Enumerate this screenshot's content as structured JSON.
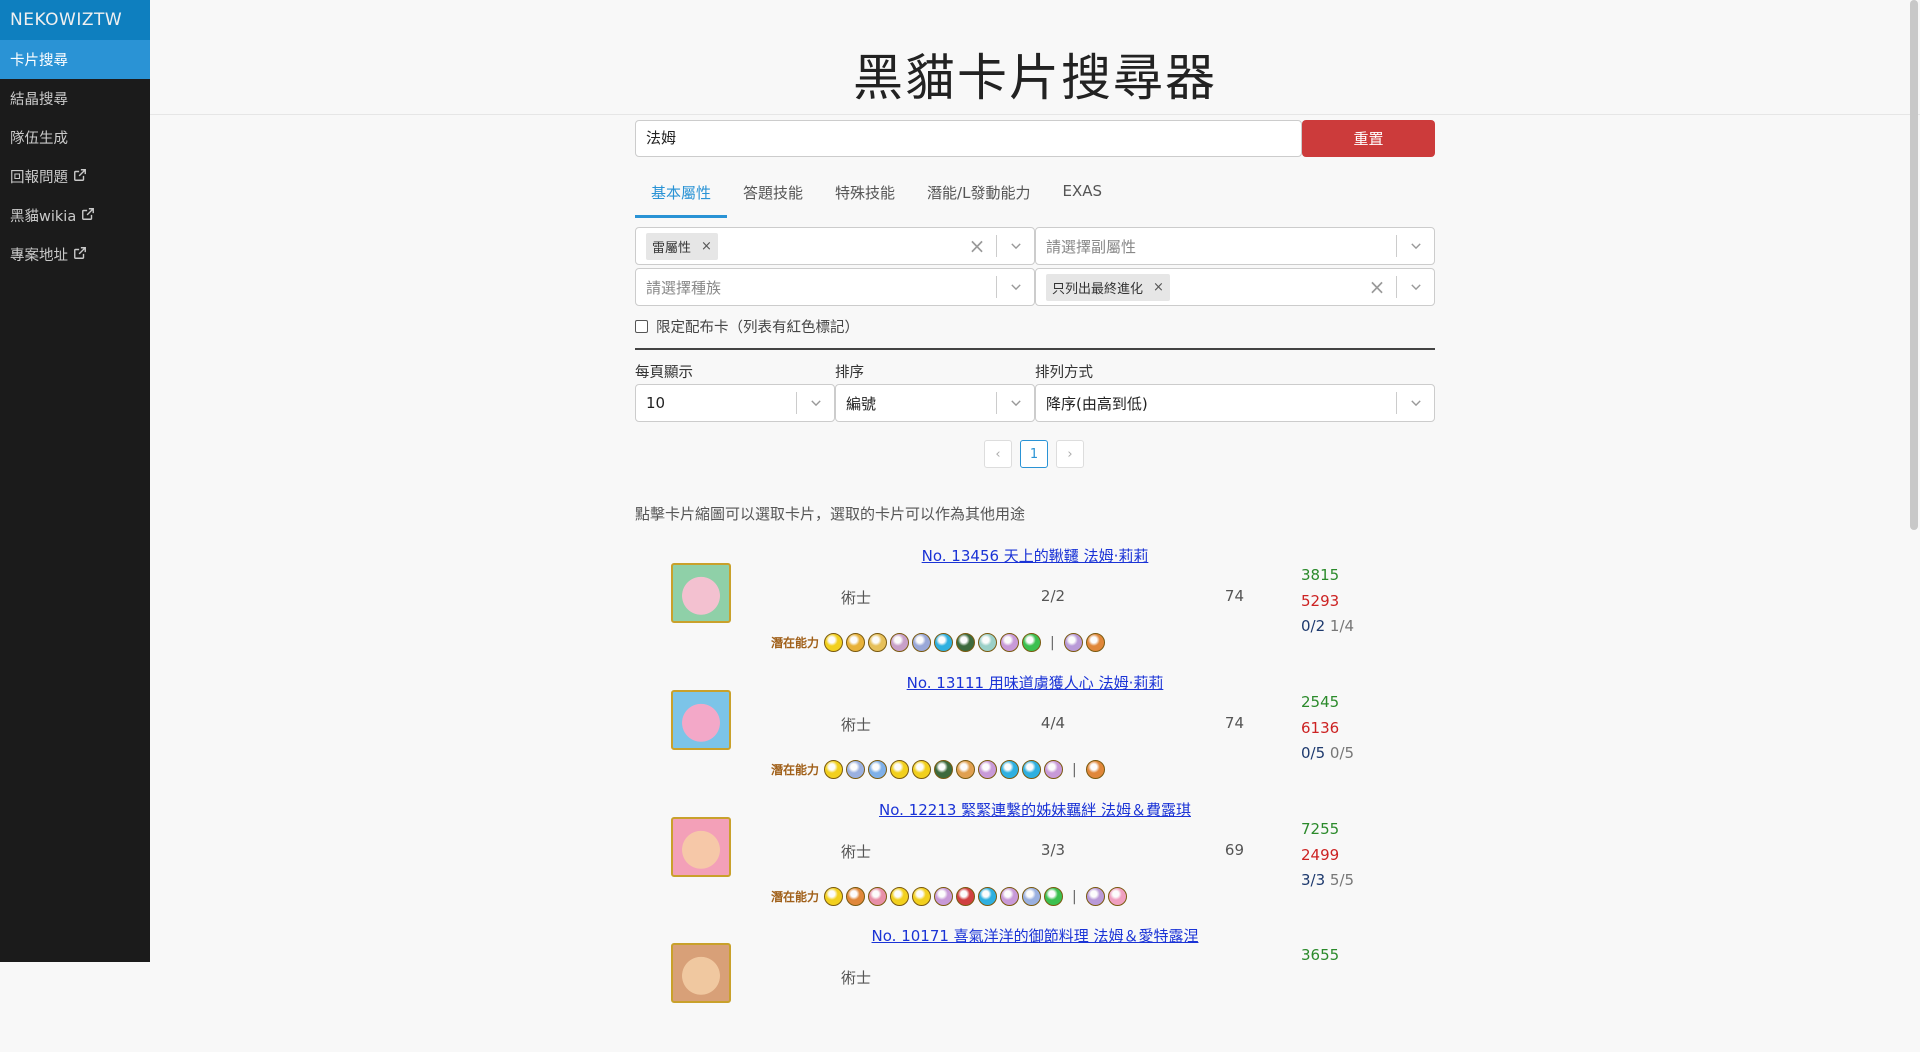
{
  "sidebar": {
    "brand": "NEKOWIZTW",
    "items": [
      {
        "label": "卡片搜尋",
        "active": true,
        "external": false
      },
      {
        "label": "結晶搜尋",
        "active": false,
        "external": false
      },
      {
        "label": "隊伍生成",
        "active": false,
        "external": false
      },
      {
        "label": "回報問題",
        "active": false,
        "external": true
      },
      {
        "label": "黑貓wikia",
        "active": false,
        "external": true
      },
      {
        "label": "專案地址",
        "active": false,
        "external": true
      }
    ]
  },
  "header": {
    "title": "黑貓卡片搜尋器"
  },
  "search": {
    "value": "法姆",
    "reset_label": "重置"
  },
  "tabs": [
    "基本屬性",
    "答題技能",
    "特殊技能",
    "潛能/L發動能力",
    "EXAS"
  ],
  "filters": {
    "main_attr_chip": "雷屬性",
    "sub_attr_placeholder": "請選擇副屬性",
    "race_placeholder": "請選擇種族",
    "evolution_chip": "只列出最終進化",
    "limited_label": "限定配布卡（列表有紅色標記）"
  },
  "options": {
    "per_page_label": "每頁顯示",
    "per_page_value": "10",
    "sort_label": "排序",
    "sort_value": "編號",
    "order_label": "排列方式",
    "order_value": "降序(由高到低)"
  },
  "pagination": {
    "prev": "‹",
    "current": "1",
    "next": "›"
  },
  "hint": "點擊卡片縮圖可以選取卡片，選取的卡片可以作為其他用途",
  "ability_label": "潛在能力",
  "cards": [
    {
      "title": "No. 13456 天上的鞦韆 法姆·莉莉",
      "class": "術士",
      "evolution": "2/2",
      "cost": "74",
      "hp": "3815",
      "atk": "5293",
      "skill_a": "0/2",
      "skill_b": "1/4",
      "thumb_colors": [
        "#f3c1d0",
        "#8fd0a8"
      ],
      "orbs": [
        "#f2d01e",
        "#e8b23a",
        "#e6c05a",
        "#c8a0c8",
        "#9aa8d8",
        "#2fb0e0",
        "#3d6a3d",
        "#9bd0c8",
        "#c89ad8",
        "#3cc050"
      ],
      "orbs2": [
        "#b99ad8",
        "#e0873a"
      ]
    },
    {
      "title": "No. 13111 用味道虜獲人心 法姆·莉莉",
      "class": "術士",
      "evolution": "4/4",
      "cost": "74",
      "hp": "2545",
      "atk": "6136",
      "skill_a": "0/5",
      "skill_b": "0/5",
      "thumb_colors": [
        "#f3a8c8",
        "#7cc4e8"
      ],
      "orbs": [
        "#f2d01e",
        "#9ab0e0",
        "#7fb0e8",
        "#f2d01e",
        "#f2d01e",
        "#3d6a3d",
        "#e0a050",
        "#c89ad8",
        "#2fb0e0",
        "#2fb0e0",
        "#c89ad8"
      ],
      "orbs2": [
        "#e0873a"
      ]
    },
    {
      "title": "No. 12213 緊緊連繫的姊妹羈絆 法姆＆費露琪",
      "class": "術士",
      "evolution": "3/3",
      "cost": "69",
      "hp": "7255",
      "atk": "2499",
      "skill_a": "3/3",
      "skill_b": "5/5",
      "thumb_colors": [
        "#f6c8a8",
        "#f3a0b8"
      ],
      "orbs": [
        "#f2d01e",
        "#e0873a",
        "#e890a8",
        "#f2d01e",
        "#f2d01e",
        "#c89ad8",
        "#d04040",
        "#2fb0e0",
        "#c89ad8",
        "#9ab0e0",
        "#3cc050"
      ],
      "orbs2": [
        "#b99ad8",
        "#f0a0c0"
      ]
    },
    {
      "title": "No. 10171 喜氣洋洋的御節料理 法姆＆愛特露涅",
      "class": "術士",
      "evolution": "",
      "cost": "",
      "hp": "3655",
      "atk": "",
      "skill_a": "",
      "skill_b": "",
      "thumb_colors": [
        "#f0c8a0",
        "#d8a078"
      ],
      "orbs": [],
      "orbs2": []
    }
  ]
}
